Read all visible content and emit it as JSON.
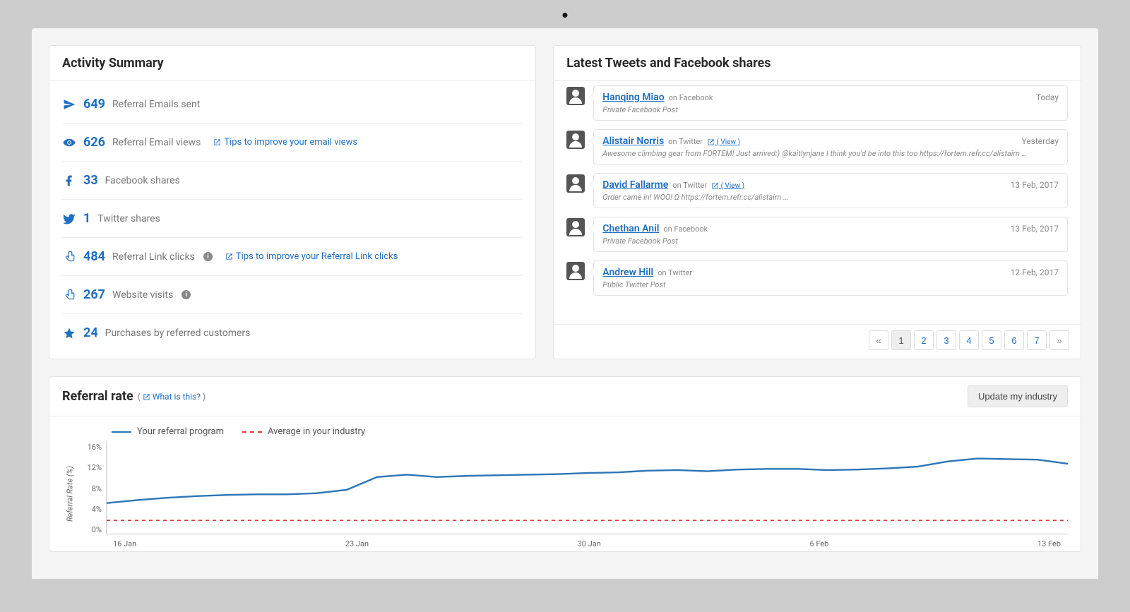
{
  "activity": {
    "title": "Activity Summary",
    "rows": [
      {
        "id": "emails-sent",
        "icon": "paper-plane",
        "count": "649",
        "label": "Referral Emails sent"
      },
      {
        "id": "email-views",
        "icon": "eye",
        "count": "626",
        "label": "Referral Email views",
        "tip": "Tips to improve your email views"
      },
      {
        "id": "fb-shares",
        "icon": "facebook",
        "count": "33",
        "label": "Facebook shares"
      },
      {
        "id": "tw-shares",
        "icon": "twitter",
        "count": "1",
        "label": "Twitter shares"
      },
      {
        "id": "link-clicks",
        "icon": "pointer",
        "count": "484",
        "label": "Referral Link clicks",
        "info": true,
        "tip": "Tips to improve your Referral Link clicks"
      },
      {
        "id": "visits",
        "icon": "pointer",
        "count": "267",
        "label": "Website visits",
        "info": true
      },
      {
        "id": "purchases",
        "icon": "star",
        "count": "24",
        "label": "Purchases by referred customers"
      }
    ]
  },
  "feed": {
    "title": "Latest Tweets and Facebook shares",
    "items": [
      {
        "name": "Hanqing Miao",
        "source": "on Facebook",
        "date": "Today",
        "body": "Private Facebook Post"
      },
      {
        "name": "Alistair Norris",
        "source": "on Twitter",
        "view": "( View )",
        "date": "Yesterday",
        "body": "Awesome climbing gear from FORTEM! Just arrived:) @kaitlynjane I think you'd be into this too https://fortem.refr.cc/alistairn …"
      },
      {
        "name": "David Fallarme",
        "source": "on Twitter",
        "view": "( View )",
        "date": "13 Feb, 2017",
        "body": "Order came in! WOO! Ω https://fortem.refr.cc/alistairn …"
      },
      {
        "name": "Chethan Anil",
        "source": "on Facebook",
        "date": "13 Feb, 2017",
        "body": "Private Facebook Post"
      },
      {
        "name": "Andrew Hill",
        "source": "on Twitter",
        "date": "12 Feb, 2017",
        "body": "Public Twitter Post"
      }
    ],
    "pages": [
      "1",
      "2",
      "3",
      "4",
      "5",
      "6",
      "7"
    ],
    "current_page": "1"
  },
  "rate": {
    "title": "Referral rate",
    "help_prefix": "( ",
    "help_link": "What is this?",
    "help_suffix": " )",
    "button": "Update my industry",
    "legend_a": "Your referral program",
    "legend_b": "Average in your industry",
    "ylabel": "Referral Rate (%)"
  },
  "chart_data": {
    "type": "line",
    "xlabel": "",
    "ylabel": "Referral Rate (%)",
    "ylim": [
      0,
      16
    ],
    "y_ticks": [
      "16%",
      "12%",
      "8%",
      "4%",
      "0%"
    ],
    "x_ticks": [
      "16 Jan",
      "23 Jan",
      "30 Jan",
      "6 Feb",
      "13 Feb"
    ],
    "series": [
      {
        "name": "Your referral program",
        "color": "#2c76b8",
        "style": "solid",
        "x": [
          "16 Jan",
          "17 Jan",
          "18 Jan",
          "19 Jan",
          "20 Jan",
          "21 Jan",
          "22 Jan",
          "23 Jan",
          "24 Jan",
          "25 Jan",
          "26 Jan",
          "27 Jan",
          "28 Jan",
          "29 Jan",
          "30 Jan",
          "31 Jan",
          "1 Feb",
          "2 Feb",
          "3 Feb",
          "4 Feb",
          "5 Feb",
          "6 Feb",
          "7 Feb",
          "8 Feb",
          "9 Feb",
          "10 Feb",
          "11 Feb",
          "12 Feb",
          "13 Feb",
          "14 Feb",
          "15 Feb",
          "16 Feb",
          "17 Feb"
        ],
        "values": [
          5.3,
          5.8,
          6.2,
          6.5,
          6.7,
          6.8,
          6.8,
          7.0,
          7.6,
          9.8,
          10.2,
          9.8,
          10.0,
          10.1,
          10.2,
          10.3,
          10.5,
          10.6,
          10.9,
          11.0,
          10.8,
          11.1,
          11.2,
          11.2,
          11.0,
          11.1,
          11.3,
          11.6,
          12.5,
          13.0,
          12.9,
          12.8,
          12.1
        ]
      },
      {
        "name": "Average in your industry",
        "color": "#e03b3b",
        "style": "dashed",
        "x": [
          "16 Jan",
          "17 Feb"
        ],
        "values": [
          2.3,
          2.3
        ]
      }
    ]
  }
}
